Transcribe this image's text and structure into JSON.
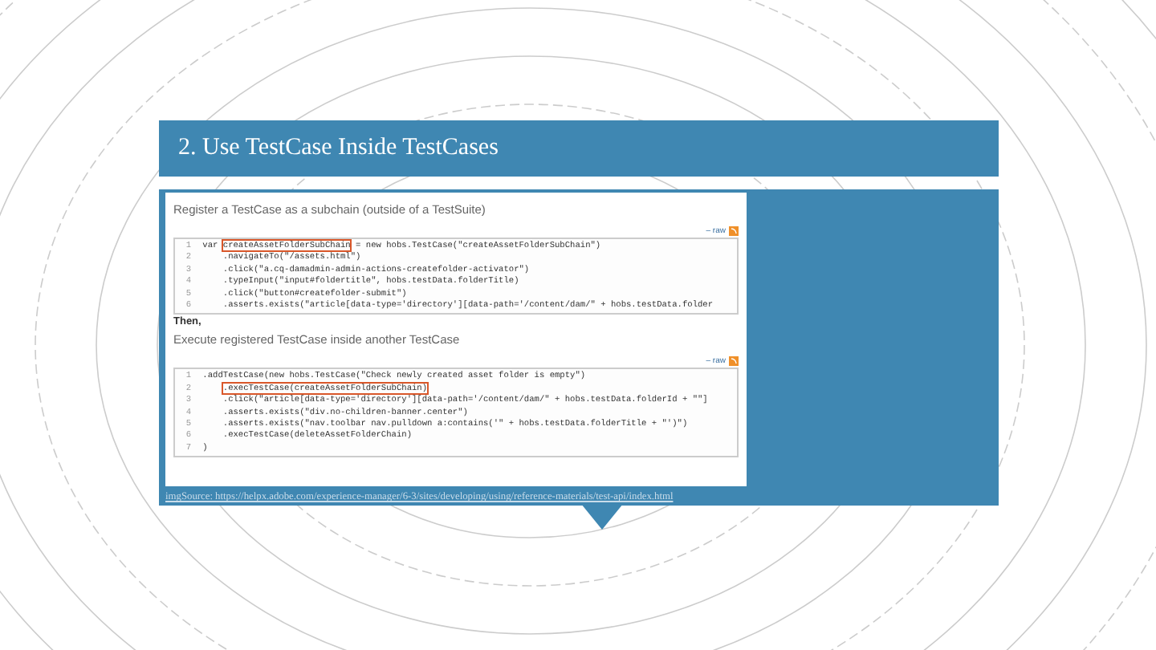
{
  "slide": {
    "title": "2. Use TestCase Inside TestCases",
    "sections": [
      {
        "heading": "Register a TestCase as a subchain (outside of a TestSuite)",
        "toolbar": "– raw",
        "lines": [
          {
            "number": "1",
            "kind": "start",
            "segments": [
              {
                "text": "var ",
                "boxed": false
              },
              {
                "text": "createAssetFolderSubChain",
                "boxed": true
              },
              {
                "text": " = new hobs.TestCase(\"createAssetFolderSubChain\")",
                "boxed": false
              }
            ]
          },
          {
            "number": "2",
            "kind": "chained",
            "segments": [
              {
                "text": ".navigateTo(\"/assets.html\")",
                "boxed": false
              }
            ]
          },
          {
            "number": "3",
            "kind": "chained",
            "segments": [
              {
                "text": ".click(\"a.cq-damadmin-admin-actions-createfolder-activator\")",
                "boxed": false
              }
            ]
          },
          {
            "number": "4",
            "kind": "chained",
            "segments": [
              {
                "text": ".typeInput(\"input#foldertitle\", hobs.testData.folderTitle)",
                "boxed": false
              }
            ]
          },
          {
            "number": "5",
            "kind": "chained",
            "segments": [
              {
                "text": ".click(\"button#createfolder-submit\")",
                "boxed": false
              }
            ]
          },
          {
            "number": "6",
            "kind": "chained",
            "segments": [
              {
                "text": ".asserts.exists(\"article[data-type='directory'][data-path='/content/dam/\" + hobs.testData.folder",
                "boxed": false
              }
            ]
          }
        ]
      },
      {
        "heading": "Execute registered TestCase inside another TestCase",
        "intro": "Then,",
        "toolbar": "– raw",
        "lines": [
          {
            "number": "1",
            "kind": "start",
            "segments": [
              {
                "text": ".addTestCase(new hobs.TestCase(\"Check newly created asset folder is empty\")",
                "boxed": false
              }
            ]
          },
          {
            "number": "2",
            "kind": "chained",
            "segments": [
              {
                "text": ".execTestCase(createAssetFolderSubChain)",
                "boxed": true
              }
            ]
          },
          {
            "number": "3",
            "kind": "chained",
            "segments": [
              {
                "text": ".click(\"article[data-type='directory'][data-path='/content/dam/\" + hobs.testData.folderId + \"\"]",
                "boxed": false
              }
            ]
          },
          {
            "number": "4",
            "kind": "chained",
            "segments": [
              {
                "text": ".asserts.exists(\"div.no-children-banner.center\")",
                "boxed": false
              }
            ]
          },
          {
            "number": "5",
            "kind": "chained",
            "segments": [
              {
                "text": ".asserts.exists(\"nav.toolbar nav.pulldown a:contains('\" + hobs.testData.folderTitle + \"')\")",
                "boxed": false
              }
            ]
          },
          {
            "number": "6",
            "kind": "chained",
            "segments": [
              {
                "text": ".execTestCase(deleteAssetFolderChain)",
                "boxed": false
              }
            ]
          },
          {
            "number": "7",
            "kind": "start",
            "segments": [
              {
                "text": ")",
                "boxed": false
              }
            ]
          }
        ]
      }
    ],
    "source": "imgSource: https://helpx.adobe.com/experience-manager/6-3/sites/developing/using/reference-materials/test-api/index.html"
  }
}
